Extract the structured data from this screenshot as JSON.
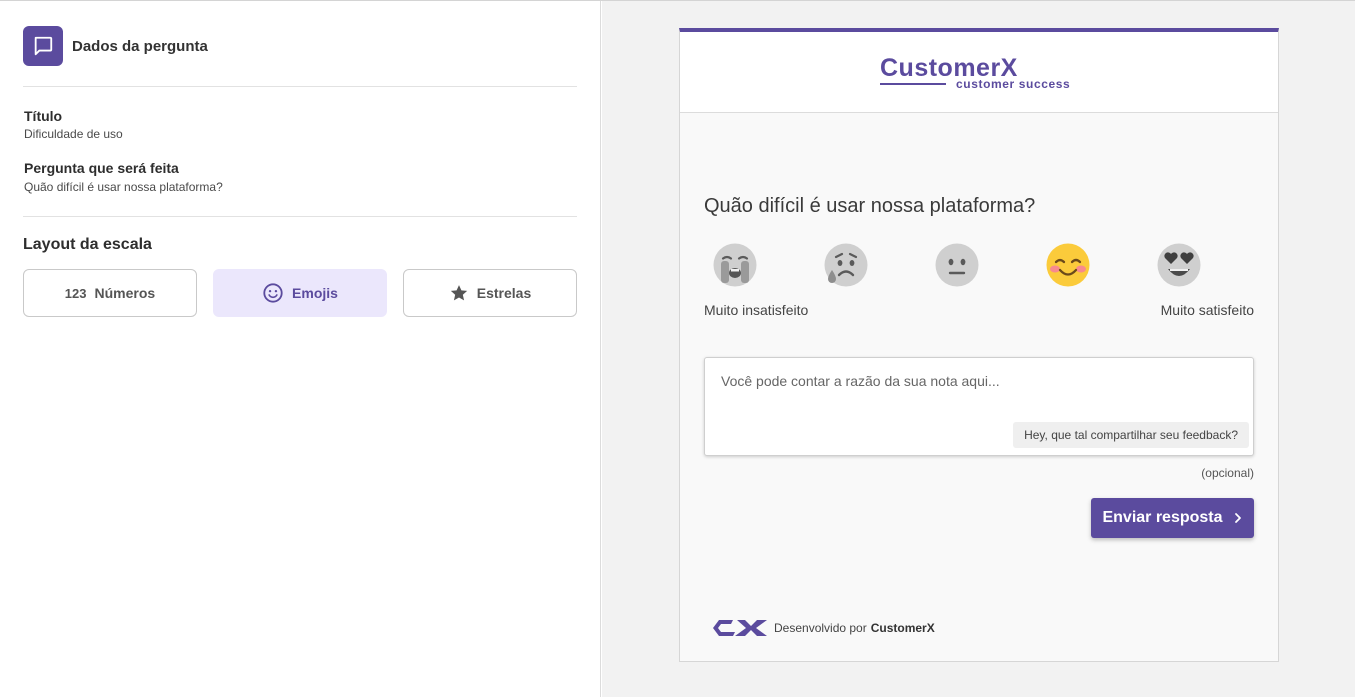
{
  "panel": {
    "header_title": "Dados da pergunta",
    "fields": [
      {
        "label": "Título",
        "value": "Dificuldade de uso"
      },
      {
        "label": "Pergunta que será feita",
        "value": "Quão difícil é usar nossa plataforma?"
      }
    ],
    "scale_section_title": "Layout da escala",
    "scale_options": [
      {
        "icon_text": "123",
        "icon": "numbers-icon",
        "label": "Números",
        "selected": false
      },
      {
        "icon": "smiley-icon",
        "label": "Emojis",
        "selected": true
      },
      {
        "icon": "star-icon",
        "label": "Estrelas",
        "selected": false
      }
    ]
  },
  "preview": {
    "logo": {
      "name": "CustomerX",
      "tagline": "customer success"
    },
    "question": "Quão difícil é usar nossa plataforma?",
    "emojis": [
      "weeping-face-icon",
      "sad-tear-face-icon",
      "neutral-face-icon",
      "smiling-face-icon",
      "heart-eyes-face-icon"
    ],
    "scale_min_label": "Muito insatisfeito",
    "scale_max_label": "Muito satisfeito",
    "textarea_placeholder": "Você pode contar a razão da sua nota aqui...",
    "feedback_tip": "Hey, que tal compartilhar seu feedback?",
    "optional_label": "(opcional)",
    "submit_label": "Enviar resposta",
    "footer_text": "Desenvolvido por",
    "footer_brand": "CustomerX"
  },
  "colors": {
    "accent": "#5b4b9e",
    "accent_light": "#ebe7fc",
    "emoji_gray": "#cdcdcd",
    "emoji_yellow": "#fbcb3b"
  }
}
